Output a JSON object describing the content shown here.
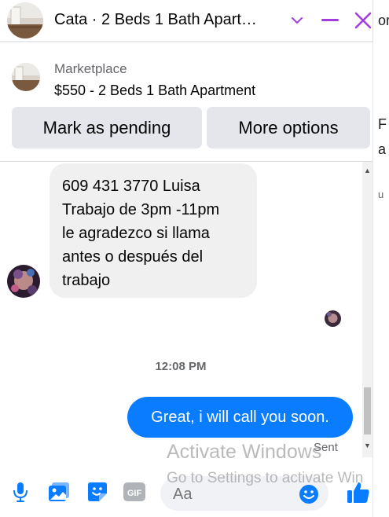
{
  "header": {
    "title": "Cata · 2 Beds 1 Bath Apart…",
    "icons": [
      "chevron-down-icon",
      "minimize-icon",
      "close-icon"
    ],
    "accent_color": "#a33ddf"
  },
  "listing": {
    "source": "Marketplace",
    "title": "$550 - 2 Beds 1 Bath Apartment",
    "mark_pending_label": "Mark as pending",
    "more_options_label": "More options"
  },
  "messages": {
    "incoming_lines": [
      "609 431 3770 Luisa",
      "Trabajo de 3pm -11pm",
      "le agradezco si llama",
      "antes o después del",
      "trabajo"
    ],
    "timestamp": "12:08 PM",
    "outgoing_text": "Great, i will call you soon.",
    "status": "Sent",
    "outgoing_color": "#0a7cff"
  },
  "composer": {
    "placeholder": "Aa",
    "icons": [
      "microphone-icon",
      "photo-icon",
      "sticker-icon",
      "gif-icon",
      "emoji-icon",
      "thumbs-up-icon"
    ],
    "gif_label": "GIF",
    "icon_color": "#0a7cff"
  },
  "watermark": {
    "line1": "Activate Windows",
    "line2": "Go to Settings to activate Win"
  },
  "background_peek": {
    "fragments": [
      "or",
      "F",
      "a",
      "u"
    ]
  }
}
